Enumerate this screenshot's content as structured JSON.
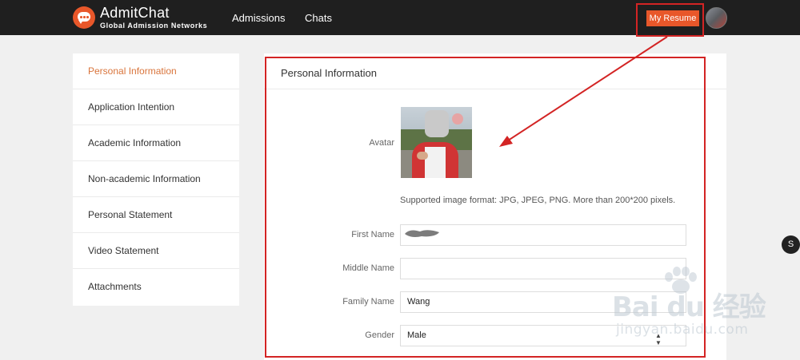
{
  "header": {
    "brand_name": "AdmitChat",
    "brand_tagline": "Global Admission Networks",
    "nav": [
      "Admissions",
      "Chats"
    ],
    "resume_button": "My Resume",
    "accent_color": "#e8572a"
  },
  "sidebar": {
    "items": [
      {
        "label": "Personal Information",
        "active": true
      },
      {
        "label": "Application Intention",
        "active": false
      },
      {
        "label": "Academic Information",
        "active": false
      },
      {
        "label": "Non-academic Information",
        "active": false
      },
      {
        "label": "Personal Statement",
        "active": false
      },
      {
        "label": "Video Statement",
        "active": false
      },
      {
        "label": "Attachments",
        "active": false
      }
    ],
    "active_color": "#d9743b"
  },
  "form": {
    "title": "Personal Information",
    "avatar_label": "Avatar",
    "avatar_hint": "Supported image format: JPG, JPEG, PNG. More than 200*200 pixels.",
    "fields": {
      "first_name": {
        "label": "First Name",
        "value": ""
      },
      "middle_name": {
        "label": "Middle Name",
        "value": ""
      },
      "family_name": {
        "label": "Family Name",
        "value": "Wang"
      },
      "gender": {
        "label": "Gender",
        "value": "Male"
      }
    }
  },
  "chat_badge": "S",
  "watermark": {
    "brand": "Bai du 经验",
    "url": "jingyan.baidu.com"
  },
  "annotation_color": "#d32424"
}
